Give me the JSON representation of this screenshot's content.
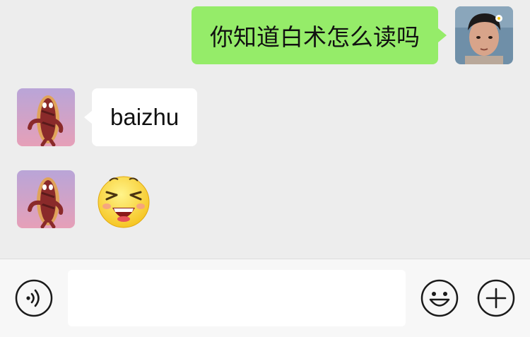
{
  "messages": [
    {
      "sender": "me",
      "type": "text",
      "text": "你知道白术怎么读吗"
    },
    {
      "sender": "them",
      "type": "text",
      "text": "baizhu"
    },
    {
      "sender": "them",
      "type": "emoji",
      "emoji": "laughing-squint-emoji"
    }
  ],
  "avatars": {
    "me": "boy-photo-avatar",
    "them": "hotdog-character-avatar"
  },
  "input_bar": {
    "voice_icon": "voice-icon",
    "text_value": "",
    "emoji_icon": "smiley-icon",
    "plus_icon": "plus-icon"
  },
  "colors": {
    "background": "#ededed",
    "my_bubble": "#95ec69",
    "their_bubble": "#ffffff",
    "input_bar": "#f7f7f7"
  }
}
